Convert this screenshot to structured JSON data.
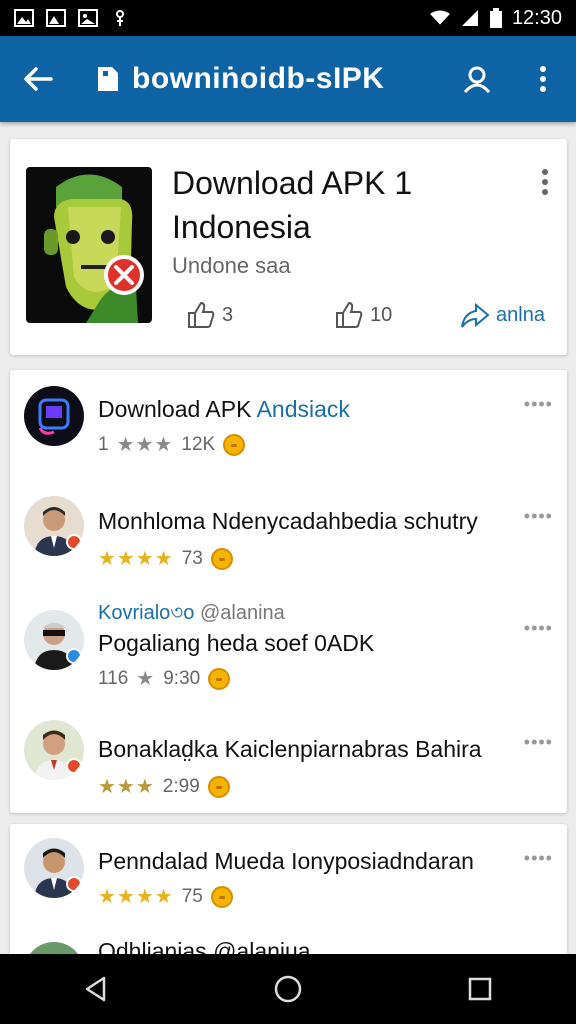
{
  "status_bar": {
    "time": "12:30",
    "icons": [
      "image-icon",
      "image-icon",
      "image-icon",
      "usb-icon",
      "wifi-icon",
      "signal-icon",
      "battery-icon"
    ]
  },
  "app_bar": {
    "title": "bowniṅoidb-sIPK",
    "icons": [
      "back-arrow-icon",
      "document-icon",
      "account-icon",
      "overflow-menu-icon"
    ]
  },
  "app_card": {
    "name": "Download APK 1 Indonesia",
    "subtitle": "Undone saa",
    "stats": [
      {
        "icon": "thumbs-up-icon",
        "label": "3"
      },
      {
        "icon": "thumbs-up-icon",
        "label": "10"
      },
      {
        "icon": "share-icon",
        "label": "anlna"
      }
    ]
  },
  "list": [
    {
      "title": "Download APK ",
      "title_accent": "Andsiack",
      "rating_text": "1",
      "stars": "★★★",
      "count": "12K",
      "avatar_color": "#1a1a2e"
    },
    {
      "title": "Monhloma Ndenycadahbedia schutry",
      "stars": "★★★★",
      "count": "73",
      "avatar_color": "#d8c7b5"
    },
    {
      "handle": "Kovrialo৩o",
      "handle_grey": "@alanina",
      "title": "Pogaliang heda soef 0ADK",
      "rating_text": "116",
      "stars": "★",
      "count": "9:30",
      "avatar_color": "#c8d3d8"
    },
    {
      "title": "Bonaklad̤ka Kaiclenpiarnabras Bahira",
      "stars": "★★★",
      "count": "2:99",
      "avatar_color": "#cfd9c0"
    }
  ],
  "list2": [
    {
      "title": "Penndalad Mueda Ionyposiadndaran",
      "stars": "★★★★",
      "count": "75",
      "avatar_color": "#cdd6de"
    },
    {
      "title": "Odhlianias @alaniua",
      "avatar_color": "#6a9a6a"
    }
  ],
  "more_label": "••••",
  "nav_bar": {
    "icons": [
      "back-triangle-icon",
      "home-circle-icon",
      "recents-square-icon"
    ]
  }
}
